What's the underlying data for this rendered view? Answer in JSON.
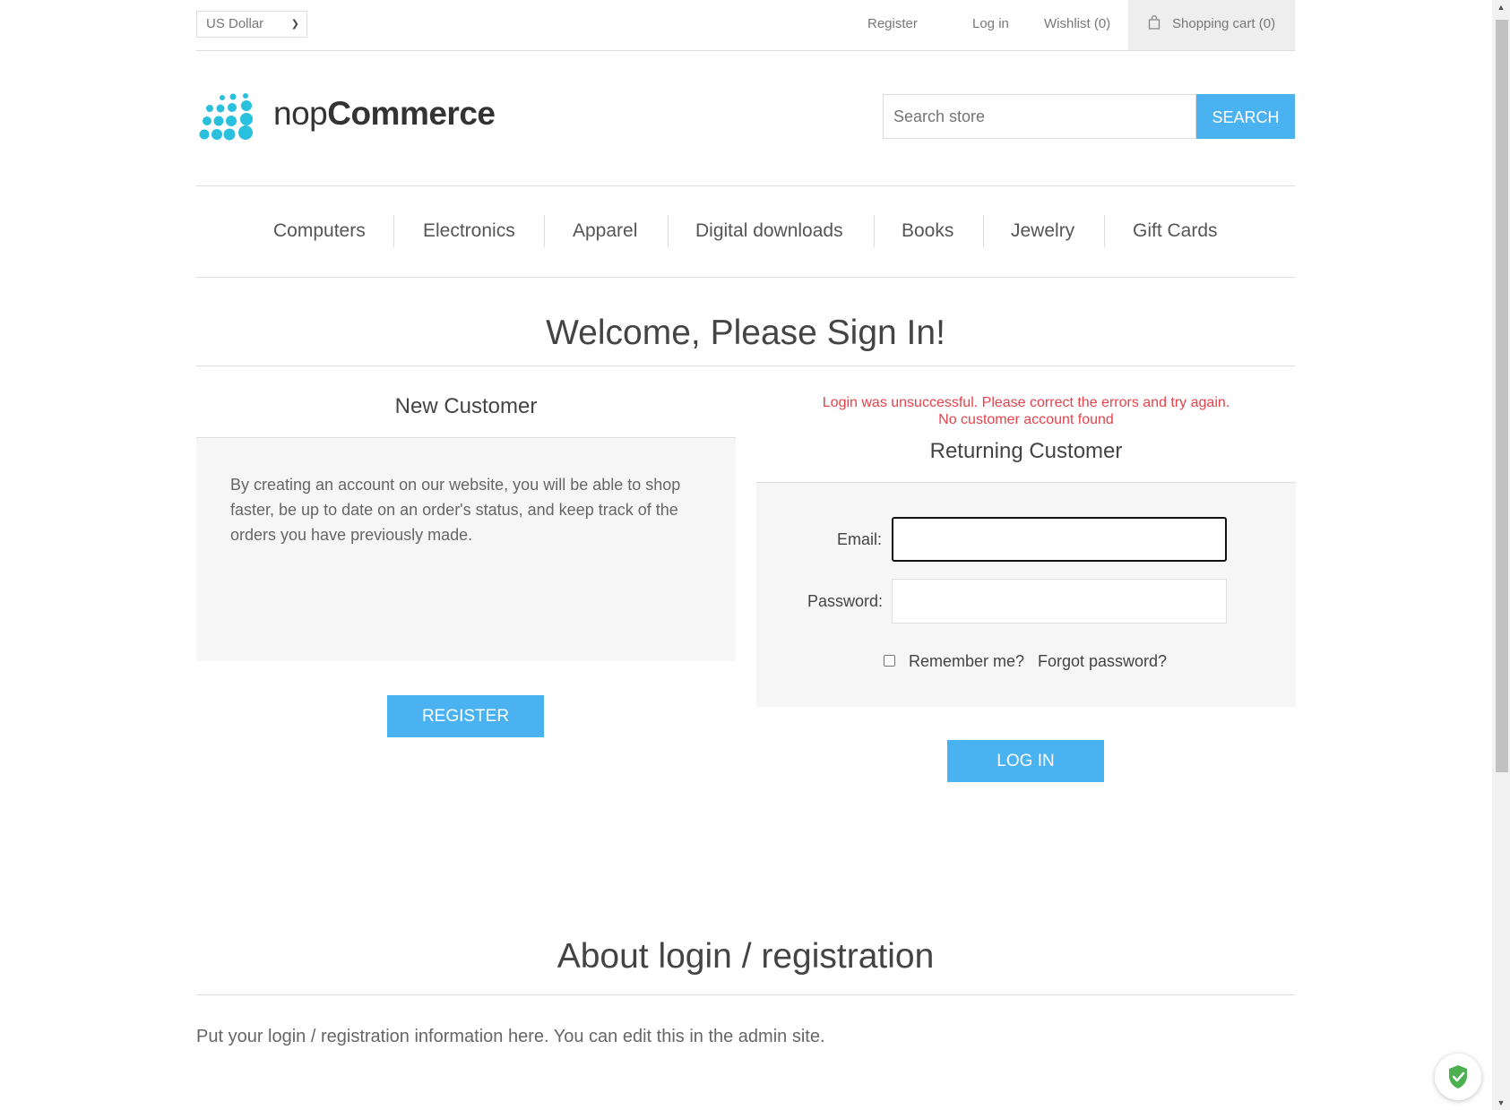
{
  "header": {
    "currency": "US Dollar",
    "links": {
      "register": "Register",
      "login": "Log in",
      "wishlist": "Wishlist (0)",
      "cart": "Shopping cart (0)"
    }
  },
  "logo": {
    "prefix": "nop",
    "suffix": "Commerce"
  },
  "search": {
    "placeholder": "Search store",
    "button": "SEARCH"
  },
  "menu": [
    "Computers",
    "Electronics",
    "Apparel",
    "Digital downloads",
    "Books",
    "Jewelry",
    "Gift Cards"
  ],
  "page_title": "Welcome, Please Sign In!",
  "new_customer": {
    "title": "New Customer",
    "text": "By creating an account on our website, you will be able to shop faster, be up to date on an order's status, and keep track of the orders you have previously made.",
    "button": "REGISTER"
  },
  "returning_customer": {
    "errors": [
      "Login was unsuccessful. Please correct the errors and try again.",
      "No customer account found"
    ],
    "title": "Returning Customer",
    "email_label": "Email:",
    "email_value": "",
    "password_label": "Password:",
    "password_value": "",
    "remember_me": "Remember me?",
    "remember_checked": false,
    "forgot_password": "Forgot password?",
    "button": "LOG IN"
  },
  "about": {
    "title": "About login / registration",
    "text": "Put your login / registration information here. You can edit this in the admin site."
  },
  "colors": {
    "accent": "#4ab2f1",
    "error": "#e4434b",
    "logo_dots": "#29c0de",
    "shield": "#4caf50"
  }
}
